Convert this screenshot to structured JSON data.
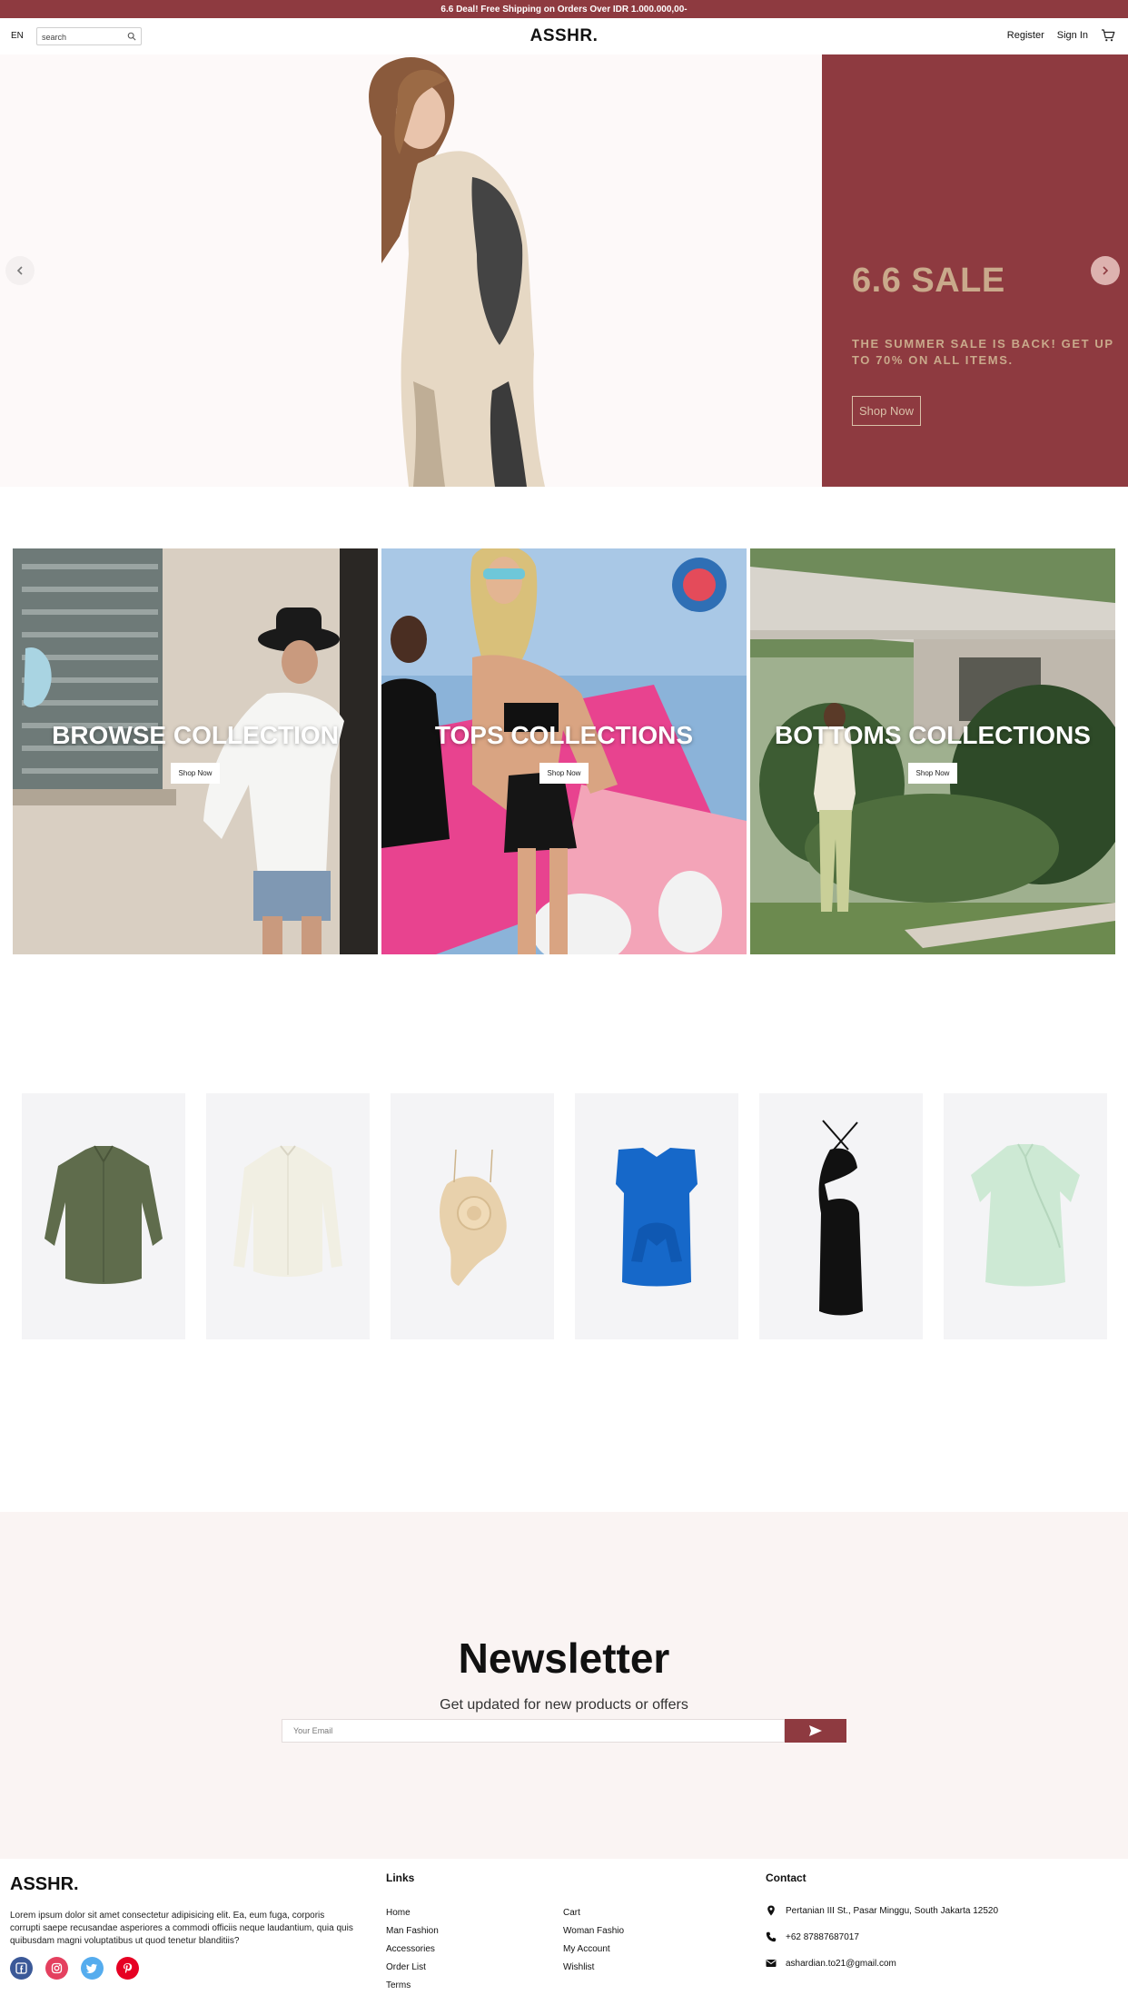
{
  "announcement": "6.6 Deal! Free Shipping on Orders Over IDR 1.000.000,00-",
  "header": {
    "lang": "EN",
    "search_placeholder": "search",
    "logo": "ASSHR.",
    "register": "Register",
    "sign_in": "Sign In"
  },
  "hero": {
    "title": "6.6 SALE",
    "subtitle": "THE SUMMER SALE IS BACK! GET UP TO 70% ON ALL ITEMS.",
    "button": "Shop Now",
    "panel_color": "#8e3a40",
    "text_color": "#c9a98b"
  },
  "collections": [
    {
      "title": "BROWSE COLLECTION",
      "button": "Shop Now"
    },
    {
      "title": "TOPS COLLECTIONS",
      "button": "Shop Now"
    },
    {
      "title": "BOTTOMS COLLECTIONS",
      "button": "Shop Now"
    }
  ],
  "products": [
    {
      "icon": "olive-linen-shirt"
    },
    {
      "icon": "cream-blouse"
    },
    {
      "icon": "beige-ruffle-top"
    },
    {
      "icon": "blue-tie-front-top"
    },
    {
      "icon": "black-cutout-dress"
    },
    {
      "icon": "mint-wrap-dress"
    }
  ],
  "newsletter": {
    "title": "Newsletter",
    "subtitle": "Get updated for new products or offers",
    "placeholder": "Your Email"
  },
  "footer": {
    "logo": "ASSHR.",
    "about": "Lorem ipsum dolor sit amet consectetur adipisicing elit. Ea, eum fuga, corporis corrupti saepe recusandae asperiores a commodi officiis neque laudantium, quia quis quibusdam magni voluptatibus ut quod tenetur blanditiis?",
    "links_heading": "Links",
    "links_col1": [
      "Home",
      "Man Fashion",
      "Accessories",
      "Order List",
      "Terms"
    ],
    "links_col2": [
      "Cart",
      "Woman Fashio",
      "My Account",
      "Wishlist"
    ],
    "contact_heading": "Contact",
    "address": "Pertanian III St., Pasar Minggu, South Jakarta 12520",
    "phone": "+62 87887687017",
    "email": "ashardian.to21@gmail.com",
    "social_colors": {
      "facebook": "#3b5998",
      "instagram": "#e4405f",
      "twitter": "#55acee",
      "pinterest": "#e60023"
    }
  }
}
